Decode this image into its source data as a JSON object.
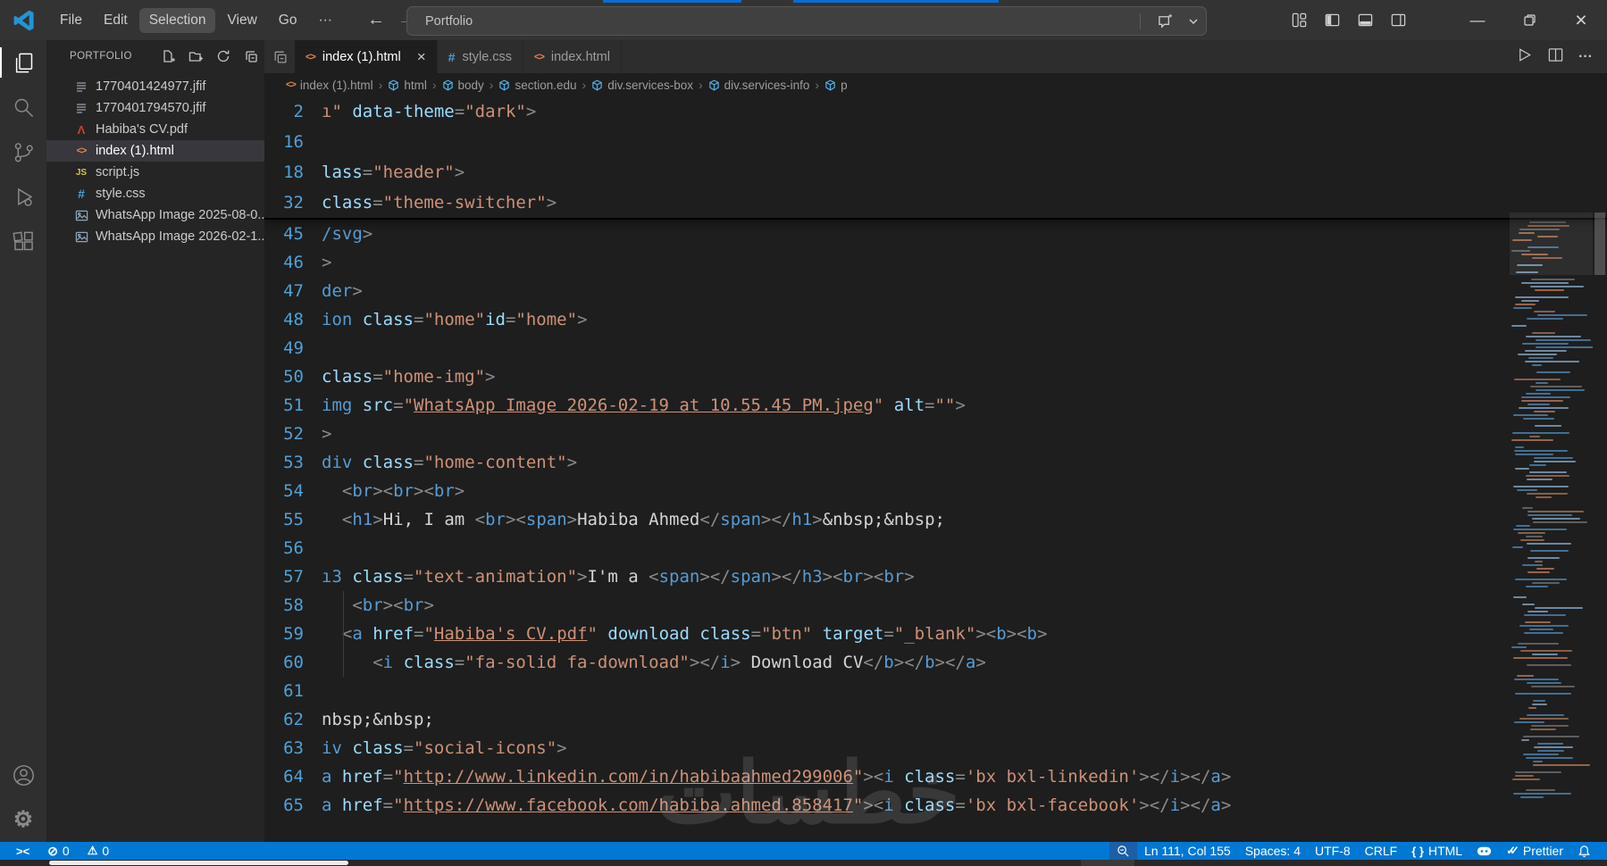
{
  "titlebar": {
    "menus": [
      {
        "label": "File"
      },
      {
        "label": "Edit"
      },
      {
        "label": "Selection",
        "active": true
      },
      {
        "label": "View"
      },
      {
        "label": "Go"
      },
      {
        "label": "···"
      }
    ],
    "command_center_label": "Portfolio",
    "window_icons": [
      "customize-layout",
      "toggle-sidebar",
      "toggle-panel",
      "toggle-secondary-sidebar"
    ],
    "window_controls": [
      "minimize",
      "restore",
      "close"
    ]
  },
  "activity_bar": {
    "top": [
      {
        "name": "explorer",
        "icon": "files-icon",
        "active": true
      },
      {
        "name": "search",
        "icon": "search-icon"
      },
      {
        "name": "source-control",
        "icon": "source-control-icon"
      },
      {
        "name": "run-and-debug",
        "icon": "debug-icon"
      },
      {
        "name": "extensions",
        "icon": "extensions-icon"
      }
    ],
    "bottom": [
      {
        "name": "accounts",
        "icon": "account-icon"
      },
      {
        "name": "settings",
        "icon": "gear-icon"
      }
    ]
  },
  "explorer": {
    "title": "PORTFOLIO",
    "actions": [
      {
        "icon": "new-file"
      },
      {
        "icon": "new-folder"
      },
      {
        "icon": "refresh"
      },
      {
        "icon": "collapse-all"
      }
    ],
    "files": [
      {
        "name": "1770401424977.jfif",
        "icon": "text-file"
      },
      {
        "name": "1770401794570.jfif",
        "icon": "text-file"
      },
      {
        "name": "Habiba's CV.pdf",
        "icon": "pdf-file"
      },
      {
        "name": "index (1).html",
        "icon": "html-file",
        "selected": true
      },
      {
        "name": "script.js",
        "icon": "js-file"
      },
      {
        "name": "style.css",
        "icon": "css-file"
      },
      {
        "name": "WhatsApp Image 2025-08-0...",
        "icon": "image-file"
      },
      {
        "name": "WhatsApp Image 2026-02-1...",
        "icon": "image-file"
      }
    ]
  },
  "tabs": [
    {
      "label": "index (1).html",
      "icon": "html-file",
      "active": true,
      "close": "×"
    },
    {
      "label": "style.css",
      "icon": "css-file"
    },
    {
      "label": "index.html",
      "icon": "html-file"
    }
  ],
  "editor_actions": [
    {
      "icon": "run"
    },
    {
      "icon": "split-editor"
    },
    {
      "icon": "more-actions"
    }
  ],
  "breadcrumbs": [
    {
      "label": "index (1).html",
      "icon": "html-file"
    },
    {
      "label": "html",
      "icon": "symbol-cube"
    },
    {
      "label": "body",
      "icon": "symbol-cube"
    },
    {
      "label": "section.edu",
      "icon": "symbol-cube"
    },
    {
      "label": "div.services-box",
      "icon": "symbol-cube"
    },
    {
      "label": "div.services-info",
      "icon": "symbol-cube"
    },
    {
      "label": "p",
      "icon": "symbol-cube"
    }
  ],
  "editor": {
    "sticky": [
      {
        "n": "2",
        "s": [
          [
            "s",
            "ı\""
          ],
          [
            "x",
            " "
          ],
          [
            "a",
            "data-theme"
          ],
          [
            "p",
            "="
          ],
          [
            "s",
            "\"dark\""
          ],
          [
            "p",
            ">"
          ]
        ]
      },
      {
        "n": "16",
        "s": []
      },
      {
        "n": "18",
        "s": [
          [
            "a",
            "lass"
          ],
          [
            "p",
            "="
          ],
          [
            "s",
            "\"header\""
          ],
          [
            "p",
            ">"
          ]
        ]
      },
      {
        "n": "32",
        "s": [
          [
            "a",
            "class"
          ],
          [
            "p",
            "="
          ],
          [
            "s",
            "\"theme-switcher\""
          ],
          [
            "p",
            ">"
          ]
        ]
      }
    ],
    "lines": [
      {
        "n": "45",
        "s": [
          [
            "t",
            "/svg"
          ],
          [
            "p",
            ">"
          ]
        ]
      },
      {
        "n": "46",
        "s": [
          [
            "p",
            ">"
          ]
        ]
      },
      {
        "n": "47",
        "s": [
          [
            "t",
            "der"
          ],
          [
            "p",
            ">"
          ]
        ]
      },
      {
        "n": "48",
        "s": [
          [
            "t",
            "ion"
          ],
          [
            "x",
            " "
          ],
          [
            "a",
            "class"
          ],
          [
            "p",
            "="
          ],
          [
            "s",
            "\"home\""
          ],
          [
            "a",
            "id"
          ],
          [
            "p",
            "="
          ],
          [
            "s",
            "\"home\""
          ],
          [
            "p",
            ">"
          ]
        ]
      },
      {
        "n": "49",
        "s": []
      },
      {
        "n": "50",
        "s": [
          [
            "a",
            "class"
          ],
          [
            "p",
            "="
          ],
          [
            "s",
            "\"home-img\""
          ],
          [
            "p",
            ">"
          ]
        ]
      },
      {
        "n": "51",
        "s": [
          [
            "t",
            "img"
          ],
          [
            "x",
            " "
          ],
          [
            "a",
            "src"
          ],
          [
            "p",
            "="
          ],
          [
            "s",
            "\""
          ],
          [
            "l",
            "WhatsApp Image 2026-02-19 at 10.55.45 PM.jpeg"
          ],
          [
            "s",
            "\""
          ],
          [
            "x",
            " "
          ],
          [
            "a",
            "alt"
          ],
          [
            "p",
            "="
          ],
          [
            "s",
            "\"\""
          ],
          [
            "p",
            ">"
          ]
        ]
      },
      {
        "n": "52",
        "s": [
          [
            "p",
            ">"
          ]
        ]
      },
      {
        "n": "53",
        "s": [
          [
            "t",
            "div"
          ],
          [
            "x",
            " "
          ],
          [
            "a",
            "class"
          ],
          [
            "p",
            "="
          ],
          [
            "s",
            "\"home-content\""
          ],
          [
            "p",
            ">"
          ]
        ]
      },
      {
        "n": "54",
        "s": [
          [
            "x",
            "  "
          ],
          [
            "p",
            "<"
          ],
          [
            "t",
            "br"
          ],
          [
            "p",
            "><"
          ],
          [
            "t",
            "br"
          ],
          [
            "p",
            "><"
          ],
          [
            "t",
            "br"
          ],
          [
            "p",
            ">"
          ]
        ]
      },
      {
        "n": "55",
        "s": [
          [
            "x",
            "  "
          ],
          [
            "p",
            "<"
          ],
          [
            "t",
            "h1"
          ],
          [
            "p",
            ">"
          ],
          [
            "x",
            "Hi, I am "
          ],
          [
            "p",
            "<"
          ],
          [
            "t",
            "br"
          ],
          [
            "p",
            "><"
          ],
          [
            "t",
            "span"
          ],
          [
            "p",
            ">"
          ],
          [
            "x",
            "Habiba Ahmed"
          ],
          [
            "p",
            "</"
          ],
          [
            "t",
            "span"
          ],
          [
            "p",
            "></"
          ],
          [
            "t",
            "h1"
          ],
          [
            "p",
            ">"
          ],
          [
            "x",
            "&nbsp;&nbsp;"
          ]
        ]
      },
      {
        "n": "56",
        "s": []
      },
      {
        "n": "57",
        "s": [
          [
            "t",
            "ı3"
          ],
          [
            "x",
            " "
          ],
          [
            "a",
            "class"
          ],
          [
            "p",
            "="
          ],
          [
            "s",
            "\"text-animation\""
          ],
          [
            "p",
            ">"
          ],
          [
            "x",
            "I'm a "
          ],
          [
            "p",
            "<"
          ],
          [
            "t",
            "span"
          ],
          [
            "p",
            "></"
          ],
          [
            "t",
            "span"
          ],
          [
            "p",
            "></"
          ],
          [
            "t",
            "h3"
          ],
          [
            "p",
            "><"
          ],
          [
            "t",
            "br"
          ],
          [
            "p",
            "><"
          ],
          [
            "t",
            "br"
          ],
          [
            "p",
            ">"
          ]
        ]
      },
      {
        "n": "58",
        "s": [
          [
            "x",
            "   "
          ],
          [
            "p",
            "<"
          ],
          [
            "t",
            "br"
          ],
          [
            "p",
            "><"
          ],
          [
            "t",
            "br"
          ],
          [
            "p",
            ">"
          ]
        ]
      },
      {
        "n": "59",
        "s": [
          [
            "x",
            "  "
          ],
          [
            "p",
            "<"
          ],
          [
            "t",
            "a"
          ],
          [
            "x",
            " "
          ],
          [
            "a",
            "href"
          ],
          [
            "p",
            "="
          ],
          [
            "s",
            "\""
          ],
          [
            "l",
            "Habiba's CV.pdf"
          ],
          [
            "s",
            "\""
          ],
          [
            "x",
            " "
          ],
          [
            "a",
            "download"
          ],
          [
            "x",
            " "
          ],
          [
            "a",
            "class"
          ],
          [
            "p",
            "="
          ],
          [
            "s",
            "\"btn\""
          ],
          [
            "x",
            " "
          ],
          [
            "a",
            "target"
          ],
          [
            "p",
            "="
          ],
          [
            "s",
            "\"_blank\""
          ],
          [
            "p",
            "><"
          ],
          [
            "t",
            "b"
          ],
          [
            "p",
            "><"
          ],
          [
            "t",
            "b"
          ],
          [
            "p",
            ">"
          ]
        ]
      },
      {
        "n": "60",
        "s": [
          [
            "x",
            "     "
          ],
          [
            "p",
            "<"
          ],
          [
            "t",
            "i"
          ],
          [
            "x",
            " "
          ],
          [
            "a",
            "class"
          ],
          [
            "p",
            "="
          ],
          [
            "s",
            "\"fa-solid fa-download\""
          ],
          [
            "p",
            "></"
          ],
          [
            "t",
            "i"
          ],
          [
            "p",
            ">"
          ],
          [
            "x",
            " Download CV"
          ],
          [
            "p",
            "</"
          ],
          [
            "t",
            "b"
          ],
          [
            "p",
            "></"
          ],
          [
            "t",
            "b"
          ],
          [
            "p",
            "></"
          ],
          [
            "t",
            "a"
          ],
          [
            "p",
            ">"
          ]
        ]
      },
      {
        "n": "61",
        "s": []
      },
      {
        "n": "62",
        "s": [
          [
            "x",
            "nbsp;&nbsp;"
          ]
        ]
      },
      {
        "n": "63",
        "s": [
          [
            "t",
            "iv"
          ],
          [
            "x",
            " "
          ],
          [
            "a",
            "class"
          ],
          [
            "p",
            "="
          ],
          [
            "s",
            "\"social-icons\""
          ],
          [
            "p",
            ">"
          ]
        ]
      },
      {
        "n": "64",
        "s": [
          [
            "t",
            "a"
          ],
          [
            "x",
            " "
          ],
          [
            "a",
            "href"
          ],
          [
            "p",
            "="
          ],
          [
            "s",
            "\""
          ],
          [
            "l",
            "http://www.linkedin.com/in/habibaahmed299006"
          ],
          [
            "s",
            "\""
          ],
          [
            "p",
            "><"
          ],
          [
            "t",
            "i"
          ],
          [
            "x",
            " "
          ],
          [
            "a",
            "class"
          ],
          [
            "p",
            "="
          ],
          [
            "s",
            "'bx bxl-linkedin'"
          ],
          [
            "p",
            "></"
          ],
          [
            "t",
            "i"
          ],
          [
            "p",
            "></"
          ],
          [
            "t",
            "a"
          ],
          [
            "p",
            ">"
          ]
        ]
      },
      {
        "n": "65",
        "s": [
          [
            "t",
            "a"
          ],
          [
            "x",
            " "
          ],
          [
            "a",
            "href"
          ],
          [
            "p",
            "="
          ],
          [
            "s",
            "\""
          ],
          [
            "l",
            "https://www.facebook.com/habiba.ahmed.858417"
          ],
          [
            "s",
            "\""
          ],
          [
            "p",
            "><"
          ],
          [
            "t",
            "i"
          ],
          [
            "x",
            " "
          ],
          [
            "a",
            "class"
          ],
          [
            "p",
            "="
          ],
          [
            "s",
            "'bx bxl-facebook'"
          ],
          [
            "p",
            "></"
          ],
          [
            "t",
            "i"
          ],
          [
            "p",
            "></"
          ],
          [
            "t",
            "a"
          ],
          [
            "p",
            ">"
          ]
        ]
      }
    ]
  },
  "status_bar": {
    "left": [
      {
        "icon": "remote"
      },
      {
        "icon": "error",
        "label": "0"
      },
      {
        "icon": "warning",
        "label": "0"
      }
    ],
    "right": [
      {
        "icon": "zoom-out",
        "boxed": true
      },
      {
        "label": "Ln 111, Col 155"
      },
      {
        "label": "Spaces: 4"
      },
      {
        "label": "UTF-8"
      },
      {
        "label": "CRLF"
      },
      {
        "icon": "braces",
        "label": "HTML"
      },
      {
        "icon": "copilot-face"
      },
      {
        "icon": "double-check",
        "label": "Prettier"
      },
      {
        "icon": "bell"
      }
    ]
  },
  "watermark": "خطسات",
  "colors": {
    "status_bar": "#0078d4",
    "title_bar": "#333333",
    "editor_background": "#1e1e1e",
    "sidebar_background": "#252526",
    "tab_strip": "#2d2d2d",
    "tag_token": "#569cd6",
    "attribute_token": "#9cdcfe",
    "string_token": "#ce9178",
    "line_number": "#4fa1d8",
    "html_icon": "#e8824a",
    "css_icon": "#4f9fd8",
    "js_icon": "#d6c349",
    "pdf_icon": "#d0402e"
  }
}
